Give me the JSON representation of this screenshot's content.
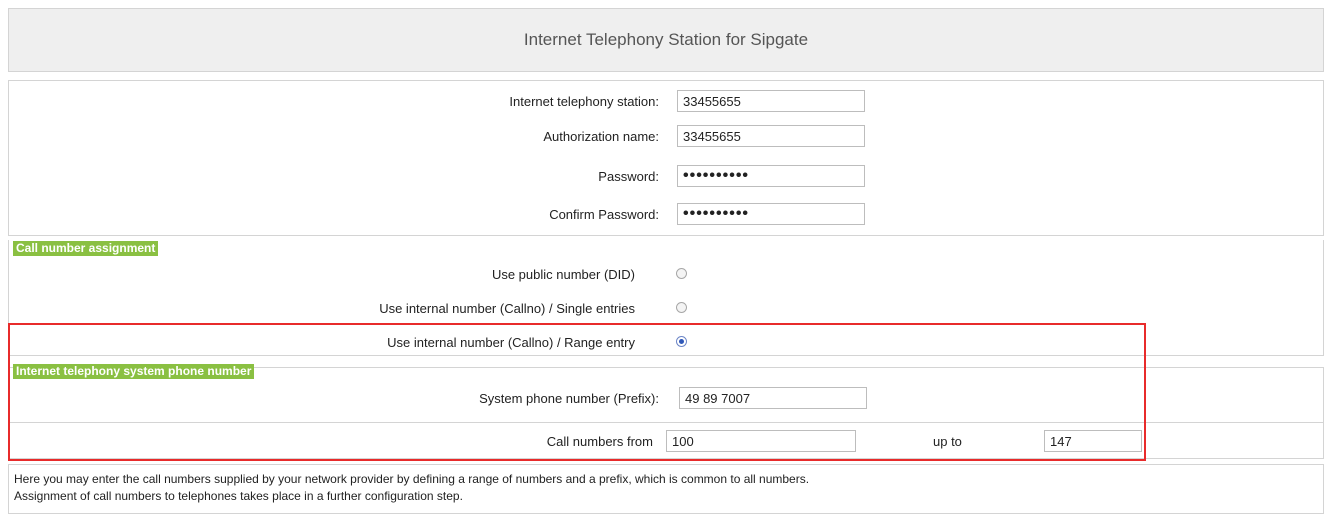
{
  "header": {
    "title": "Internet Telephony Station for Sipgate"
  },
  "fields": {
    "station": {
      "label": "Internet telephony station:",
      "value": "33455655"
    },
    "auth_name": {
      "label": "Authorization name:",
      "value": "33455655"
    },
    "password": {
      "label": "Password:",
      "value": "••••••••••"
    },
    "confirm_password": {
      "label": "Confirm Password:",
      "value": "••••••••••"
    }
  },
  "assignment": {
    "section_title": "Call number assignment",
    "options": [
      {
        "label": "Use public number (DID)",
        "checked": false
      },
      {
        "label": "Use internal number (Callno) / Single entries",
        "checked": false
      },
      {
        "label": "Use internal number (Callno) / Range entry",
        "checked": true
      }
    ]
  },
  "system_number": {
    "section_title": "Internet telephony system phone number",
    "prefix_label": "System phone number (Prefix):",
    "prefix_value": "49 89 7007",
    "from_label": "Call numbers from",
    "from_value": "100",
    "to_label": "up to",
    "to_value": "147"
  },
  "note": {
    "line1": "Here you may enter the call numbers supplied by your network provider by defining a range of numbers and a prefix, which is common to all numbers.",
    "line2": "Assignment of call numbers to telephones takes place in a further configuration step."
  },
  "colors": {
    "section_tag": "#8ac042",
    "highlight": "#e82b2b",
    "radio_selected": "#2f58b8"
  }
}
